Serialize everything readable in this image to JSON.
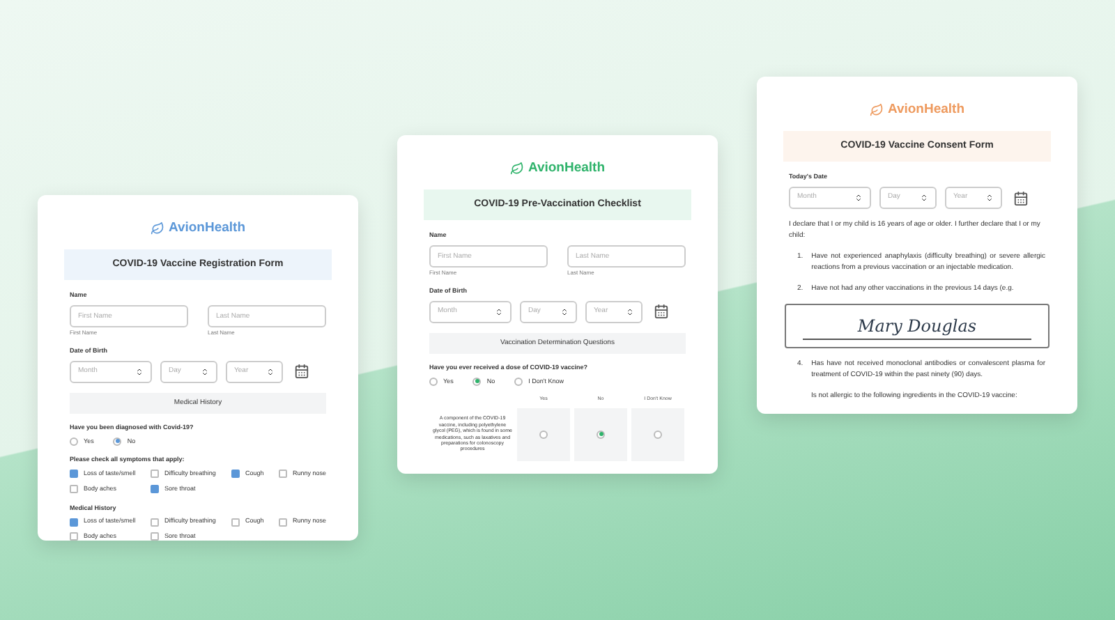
{
  "forms": [
    {
      "brand": "AvionHealth",
      "color": "#5b97d8",
      "title": "COVID-19 Vaccine Registration Form",
      "sections": [
        {
          "kind": "name",
          "label": "Name",
          "fields": [
            {
              "placeholder": "First Name",
              "caption": "First Name"
            },
            {
              "placeholder": "Last Name",
              "caption": "Last Name"
            }
          ]
        },
        {
          "kind": "date",
          "label": "Date of Birth",
          "selects": [
            "Month",
            "Day",
            "Year"
          ]
        },
        {
          "kind": "heading",
          "text": "Medical History"
        },
        {
          "kind": "radio",
          "question": "Have you been diagnosed with Covid-19?",
          "options": [
            {
              "label": "Yes",
              "selected": false
            },
            {
              "label": "No",
              "selected": true
            }
          ]
        },
        {
          "kind": "checks",
          "label": "Please check all symptoms that apply:",
          "options": [
            {
              "label": "Loss of taste/smell",
              "checked": true
            },
            {
              "label": "Difficulty breathing",
              "checked": false
            },
            {
              "label": "Cough",
              "checked": true
            },
            {
              "label": "Runny nose",
              "checked": false
            },
            {
              "label": "Body aches",
              "checked": false
            },
            {
              "label": "Sore throat",
              "checked": true
            }
          ]
        },
        {
          "kind": "checks",
          "label": "Medical History",
          "options": [
            {
              "label": "Loss of taste/smell",
              "checked": true
            },
            {
              "label": "Difficulty breathing",
              "checked": false
            },
            {
              "label": "Cough",
              "checked": false
            },
            {
              "label": "Runny nose",
              "checked": false
            },
            {
              "label": "Body aches",
              "checked": false
            },
            {
              "label": "Sore throat",
              "checked": false
            }
          ]
        }
      ]
    },
    {
      "brand": "AvionHealth",
      "color": "#2fb36b",
      "title": "COVID-19 Pre-Vaccination Checklist",
      "sections": [
        {
          "kind": "name",
          "label": "Name",
          "fields": [
            {
              "placeholder": "First Name",
              "caption": "First Name"
            },
            {
              "placeholder": "Last Name",
              "caption": "Last Name"
            }
          ]
        },
        {
          "kind": "date",
          "label": "Date of Birth",
          "selects": [
            "Month",
            "Day",
            "Year"
          ]
        },
        {
          "kind": "heading",
          "text": "Vaccination Determination Questions"
        },
        {
          "kind": "radio",
          "question": "Have you ever received a dose of COVID-19 vaccine?",
          "options": [
            {
              "label": "Yes",
              "selected": false
            },
            {
              "label": "No",
              "selected": true
            },
            {
              "label": "I Don't Know",
              "selected": false
            }
          ]
        },
        {
          "kind": "matrix",
          "columns": [
            "Yes",
            "No",
            "I Don't Know"
          ],
          "rows": [
            {
              "text": "A component of the COVID-19 vaccine, including polyethylene glycol (PEG), which is found in some medications, such as laxatives and preparations for colonoscopy procedures",
              "cells": [
                {
                  "selected": false
                },
                {
                  "selected": true
                },
                {
                  "selected": false
                }
              ]
            }
          ]
        }
      ]
    },
    {
      "brand": "AvionHealth",
      "color": "#ee9a5e",
      "title": "COVID-19 Vaccine Consent Form",
      "sections": [
        {
          "kind": "date",
          "label": "Today's Date",
          "selects": [
            "Month",
            "Day",
            "Year"
          ]
        },
        {
          "kind": "paragraph",
          "text": "I declare that I or my child is 16 years of age or older. I further declare that I or my child:"
        },
        {
          "kind": "list",
          "items": [
            {
              "number": "1.",
              "text": "Have not experienced anaphylaxis (difficulty breathing) or severe allergic reactions from a previous vaccination or an injectable medication."
            },
            {
              "number": "2.",
              "text": "Have not had any other vaccinations in the previous 14 days (e.g."
            }
          ]
        },
        {
          "kind": "signature",
          "text": "Mary Douglas"
        },
        {
          "kind": "list",
          "items": [
            {
              "number": "4.",
              "text": "Has have not received monoclonal antibodies or convalescent plasma for treatment of COVID-19 within the past ninety (90) days."
            }
          ]
        },
        {
          "kind": "paragraph",
          "text": "Is not allergic to the following ingredients in the COVID-19 vaccine:",
          "indent": true
        }
      ]
    }
  ]
}
